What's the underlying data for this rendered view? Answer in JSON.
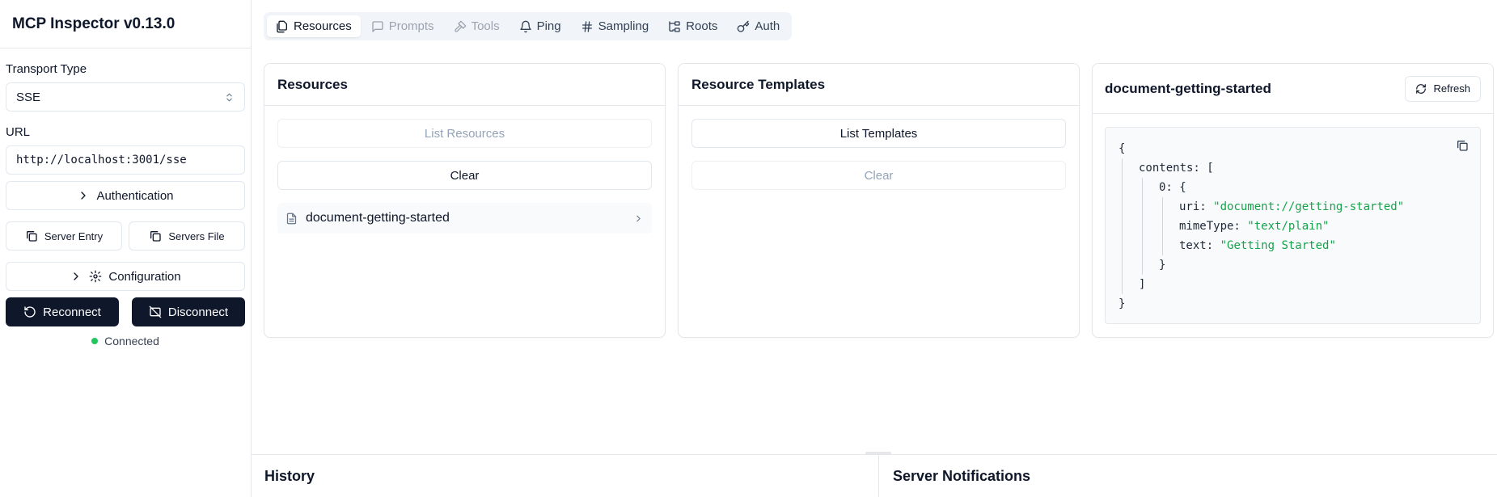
{
  "app": {
    "title": "MCP Inspector v0.13.0"
  },
  "sidebar": {
    "transport_label": "Transport Type",
    "transport_value": "SSE",
    "url_label": "URL",
    "url_value": "http://localhost:3001/sse",
    "authentication_label": "Authentication",
    "server_entry_label": "Server Entry",
    "servers_file_label": "Servers File",
    "configuration_label": "Configuration",
    "reconnect_label": "Reconnect",
    "disconnect_label": "Disconnect",
    "status_text": "Connected",
    "status_color": "#22c55e"
  },
  "tabs": [
    {
      "label": "Resources",
      "icon": "files-icon",
      "state": "active"
    },
    {
      "label": "Prompts",
      "icon": "message-square-icon",
      "state": "disabled"
    },
    {
      "label": "Tools",
      "icon": "hammer-icon",
      "state": "disabled"
    },
    {
      "label": "Ping",
      "icon": "bell-icon",
      "state": "normal"
    },
    {
      "label": "Sampling",
      "icon": "hash-icon",
      "state": "normal"
    },
    {
      "label": "Roots",
      "icon": "folder-tree-icon",
      "state": "normal"
    },
    {
      "label": "Auth",
      "icon": "key-icon",
      "state": "normal"
    }
  ],
  "resources": {
    "title": "Resources",
    "list_button": "List Resources",
    "clear_button": "Clear",
    "items": [
      {
        "name": "document-getting-started"
      }
    ]
  },
  "templates": {
    "title": "Resource Templates",
    "list_button": "List Templates",
    "clear_button": "Clear"
  },
  "detail": {
    "title": "document-getting-started",
    "refresh_label": "Refresh",
    "json": {
      "open": "{",
      "contents_key": "contents:",
      "contents_open": "[",
      "item_key": "0:",
      "item_open": "{",
      "uri_key": "uri:",
      "uri_value": "\"document://getting-started\"",
      "mime_key": "mimeType:",
      "mime_value": "\"text/plain\"",
      "text_key": "text:",
      "text_value": "\"Getting Started\"",
      "item_close": "}",
      "contents_close": "]",
      "close": "}"
    }
  },
  "bottom": {
    "history_title": "History",
    "notifications_title": "Server Notifications"
  }
}
